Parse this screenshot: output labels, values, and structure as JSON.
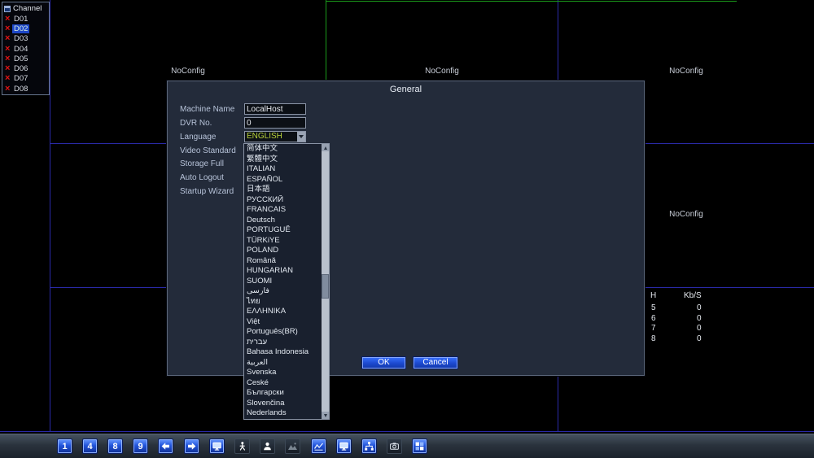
{
  "colors": {
    "accent_blue": "#1d50d8",
    "grid_line_blue": "#2a2aa8",
    "selection_green": "#1a9a1a",
    "language_highlight": "#b8d23a",
    "channel_error_red": "#e41414",
    "channel_selected_bg": "#1e47c8"
  },
  "channel_panel": {
    "title": "Channel",
    "items": [
      {
        "id": "D01",
        "selected": false
      },
      {
        "id": "D02",
        "selected": true
      },
      {
        "id": "D03",
        "selected": false
      },
      {
        "id": "D04",
        "selected": false
      },
      {
        "id": "D05",
        "selected": false
      },
      {
        "id": "D06",
        "selected": false
      },
      {
        "id": "D07",
        "selected": false
      },
      {
        "id": "D08",
        "selected": false
      }
    ]
  },
  "video_grid": {
    "cell_label": "NoConfig"
  },
  "bitrate_table": {
    "headers": [
      "H",
      "Kb/S"
    ],
    "rows": [
      [
        "5",
        "0"
      ],
      [
        "6",
        "0"
      ],
      [
        "7",
        "0"
      ],
      [
        "8",
        "0"
      ]
    ]
  },
  "dialog": {
    "title": "General",
    "machine_name": {
      "label": "Machine Name",
      "value": "LocalHost"
    },
    "dvr_no": {
      "label": "DVR No.",
      "value": "0"
    },
    "language": {
      "label": "Language",
      "value": "ENGLISH"
    },
    "video_standard_label": "Video Standard",
    "storage_full_label": "Storage Full",
    "auto_logout_label": "Auto Logout",
    "startup_wizard_label": "Startup Wizard",
    "language_options": [
      "简体中文",
      "繁體中文",
      "ITALIAN",
      "ESPAÑOL",
      "日本語",
      "РУССКИЙ",
      "FRANCAIS",
      "Deutsch",
      "PORTUGUÊ",
      "TÜRKiYE",
      "POLAND",
      "Română",
      "HUNGARIAN",
      "SUOMI",
      "فارسی",
      "ไทย",
      "ΕΛΛΗΝΙΚΑ",
      "Việt",
      "Português(BR)",
      "עברית",
      "Bahasa Indonesia",
      "العربية",
      "Svenska",
      "Ceské",
      "Български",
      "Slovenčina",
      "Nederlands"
    ],
    "ok_label": "OK",
    "cancel_label": "Cancel"
  },
  "taskbar": {
    "buttons": [
      {
        "name": "single-view",
        "glyph": "1",
        "variant": "blue"
      },
      {
        "name": "quad-view",
        "glyph": "4",
        "variant": "blue"
      },
      {
        "name": "eight-view",
        "glyph": "8",
        "variant": "blue"
      },
      {
        "name": "nine-view",
        "glyph": "9",
        "variant": "blue"
      },
      {
        "name": "page-left",
        "icon": "arrow-left-icon",
        "variant": "blue"
      },
      {
        "name": "page-right",
        "icon": "arrow-right-icon",
        "variant": "blue"
      },
      {
        "name": "screen",
        "icon": "monitor-icon",
        "variant": "blue"
      },
      {
        "name": "ptz",
        "icon": "walking-person-icon",
        "variant": "dark"
      },
      {
        "name": "user",
        "icon": "person-icon",
        "variant": "dark"
      },
      {
        "name": "color-setting",
        "icon": "mountain-icon",
        "variant": "dark"
      },
      {
        "name": "waveform",
        "icon": "chart-icon",
        "variant": "blue"
      },
      {
        "name": "display",
        "icon": "monitor-icon",
        "variant": "blue"
      },
      {
        "name": "network",
        "icon": "network-icon",
        "variant": "blue"
      },
      {
        "name": "snapshot",
        "icon": "camera-icon",
        "variant": "dark"
      },
      {
        "name": "multi-channel",
        "icon": "grid-icon",
        "variant": "blue"
      }
    ]
  }
}
